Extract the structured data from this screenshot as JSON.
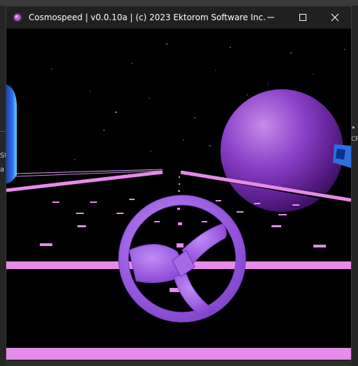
{
  "window": {
    "title": "Cosmospeed | v0.0.10a | (c) 2023 Ektorom Software Inc.",
    "controls": [
      "minimize-icon",
      "maximize-icon",
      "close-icon"
    ]
  },
  "background_windows": {
    "left_text_1": "St",
    "left_text_2": "a",
    "right_text": "CP"
  },
  "scene": {
    "colors": {
      "space": "#000000",
      "road_lines": "#e58be8",
      "planet": "#7a2fb8",
      "steering_wheel": "#9a5ae0"
    },
    "elements": [
      "star-field",
      "planet",
      "road",
      "steering-wheel",
      "left-blue-object",
      "right-blue-object"
    ]
  }
}
